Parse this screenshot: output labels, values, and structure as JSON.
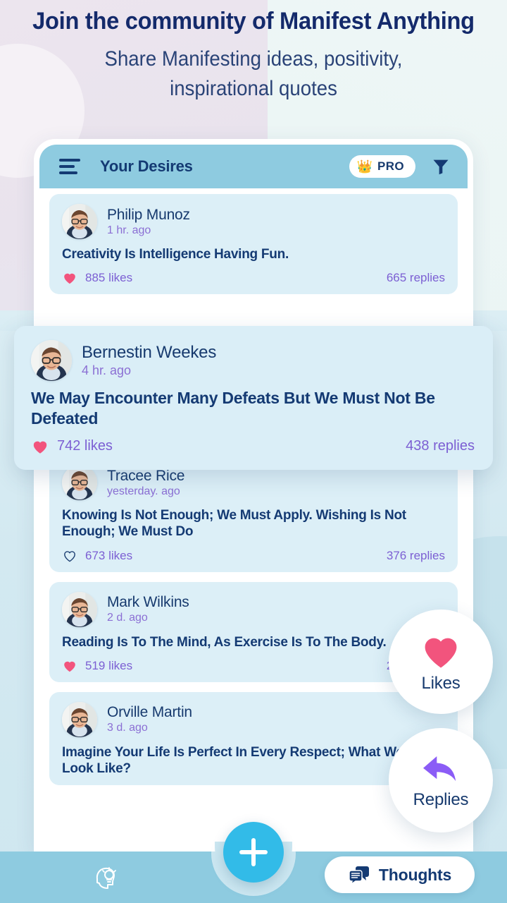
{
  "hero": {
    "headline": "Join the community of Manifest Anything",
    "subheadline_line1": "Share Manifesting ideas, positivity,",
    "subheadline_line2": "inspirational quotes"
  },
  "appbar": {
    "menu_icon": "hamburger-menu-icon",
    "title": "Your Desires",
    "pro_badge": {
      "crown": "👑",
      "label": "PRO"
    },
    "filter_icon": "filter-funnel-icon"
  },
  "feed": {
    "posts": [
      {
        "author": "Philip Munoz",
        "timestamp": "1 hr. ago",
        "quote": "Creativity Is Intelligence Having Fun.",
        "likes": "885 likes",
        "replies": "665 replies",
        "liked": true
      },
      {
        "author": "Bernestin Weekes",
        "timestamp": "4 hr. ago",
        "quote": "We May Encounter Many Defeats But We Must Not Be Defeated",
        "likes": "742 likes",
        "replies": "438 replies",
        "liked": true
      },
      {
        "author": "Tracee Rice",
        "timestamp": "yesterday. ago",
        "quote": "Knowing Is Not Enough; We Must Apply. Wishing Is Not Enough; We Must Do",
        "likes": "673 likes",
        "replies": "376 replies",
        "liked": false
      },
      {
        "author": "Mark Wilkins",
        "timestamp": "2 d. ago",
        "quote": "Reading Is To The Mind, As Exercise Is To The Body.",
        "likes": "519 likes",
        "replies": "248 replies",
        "liked": true
      },
      {
        "author": "Orville Martin",
        "timestamp": "3 d. ago",
        "quote": "Imagine Your Life Is Perfect In Every Respect; What Would It Look Like?",
        "likes": "",
        "replies": "",
        "liked": false
      }
    ]
  },
  "floating_actions": [
    {
      "label": "Likes",
      "icon": "heart-icon"
    },
    {
      "label": "Replies",
      "icon": "reply-arrow-icon"
    }
  ],
  "bottombar": {
    "idea_icon": "head-lightbulb-icon",
    "fab_icon": "plus-icon",
    "thoughts": {
      "icon": "speech-bubbles-icon",
      "label": "Thoughts"
    }
  },
  "colors": {
    "accent_blue": "#32bbe8",
    "appbar_blue": "#8ecbe0",
    "card_blue": "#dceff7",
    "navy": "#143a73",
    "purple_text": "#7c5fd3",
    "heart_pink": "#f2547d",
    "reply_purple": "#8b5cf6"
  }
}
